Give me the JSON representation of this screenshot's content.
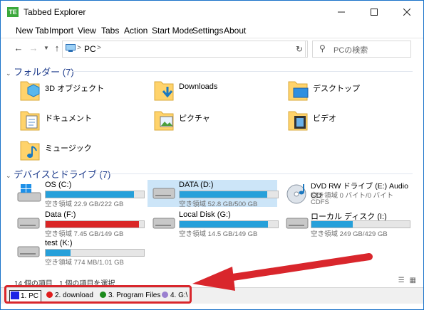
{
  "window": {
    "title": "Tabbed Explorer",
    "icon_text": "TE"
  },
  "menu": [
    "New Tab",
    "Import",
    "View",
    "Tabs",
    "Action",
    "Start Mode",
    "Settings",
    "About"
  ],
  "address": {
    "segments": "PC",
    "sep": ">",
    "search_placeholder": "PCの検索"
  },
  "folders_section": {
    "title": "フォルダー (7)"
  },
  "folders": [
    {
      "label": "3D オブジェクト",
      "icon": "3d-objects-folder-icon"
    },
    {
      "label": "Downloads",
      "icon": "downloads-folder-icon"
    },
    {
      "label": "デスクトップ",
      "icon": "desktop-folder-icon"
    },
    {
      "label": "ドキュメント",
      "icon": "documents-folder-icon"
    },
    {
      "label": "ピクチャ",
      "icon": "pictures-folder-icon"
    },
    {
      "label": "ビデオ",
      "icon": "videos-folder-icon"
    },
    {
      "label": "ミュージック",
      "icon": "music-folder-icon"
    }
  ],
  "drives_section": {
    "title": "デバイスとドライブ (7)"
  },
  "drives": [
    {
      "name": "OS (C:)",
      "free": "空き領域 22.9 GB/222 GB",
      "used": 0.9,
      "selected": false,
      "icon": "windows-drive-icon",
      "bar": "blue"
    },
    {
      "name": "DATA (D:)",
      "free": "空き領域 52.8 GB/500 GB",
      "used": 0.89,
      "selected": true,
      "icon": "hard-drive-icon",
      "bar": "blue"
    },
    {
      "name": "DVD RW ドライブ (E:) Audio CD",
      "free": "空き領域 0 バイト/0 バイト",
      "extra": "CDFS",
      "used": null,
      "selected": false,
      "icon": "dvd-drive-icon"
    },
    {
      "name": "Data (F:)",
      "free": "空き領域 7.45 GB/149 GB",
      "used": 0.95,
      "selected": false,
      "icon": "hard-drive-icon",
      "bar": "red"
    },
    {
      "name": "Local Disk (G:)",
      "free": "空き領域 14.5 GB/149 GB",
      "used": 0.9,
      "selected": false,
      "icon": "hard-drive-icon",
      "bar": "blue"
    },
    {
      "name": "ローカル ディスク (I:)",
      "free": "空き領域 249 GB/429 GB",
      "used": 0.42,
      "selected": false,
      "icon": "hard-drive-icon",
      "bar": "blue"
    },
    {
      "name": "test (K:)",
      "free": "空き領域 774 MB/1.01 GB",
      "used": 0.25,
      "selected": false,
      "icon": "hard-drive-icon",
      "bar": "blue"
    }
  ],
  "status": {
    "items": "14 個の項目",
    "selected": "1 個の項目を選択"
  },
  "tabs": [
    {
      "label": "1. PC",
      "color": "#1b24e6",
      "active": true
    },
    {
      "label": "2. download",
      "color": "#e01b1b",
      "active": false
    },
    {
      "label": "3. Program Files",
      "color": "#1b8a1b",
      "active": false
    },
    {
      "label": "4. G:\\",
      "color": "#9a7fd0",
      "active": false
    }
  ],
  "colors": {
    "accent": "#26a0da",
    "annotation": "#d9262c"
  }
}
